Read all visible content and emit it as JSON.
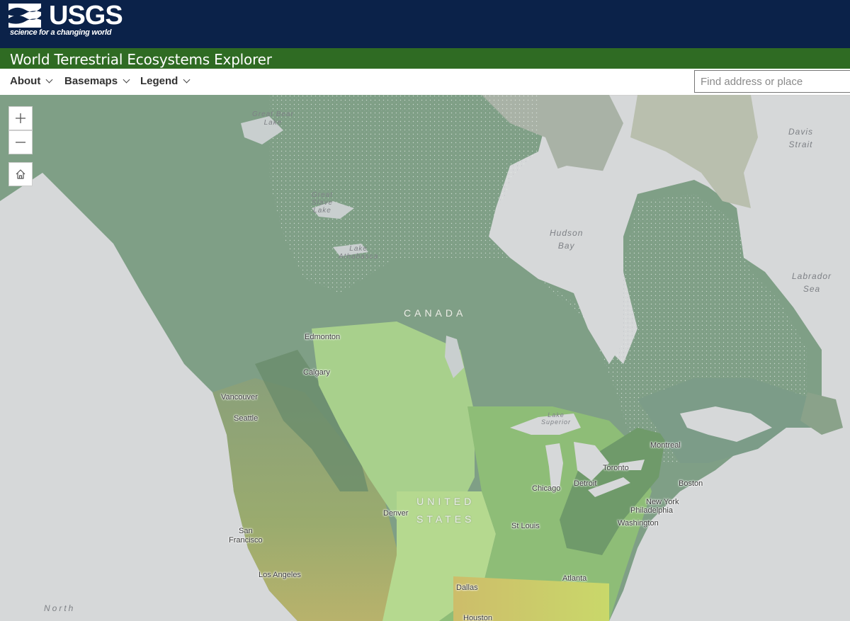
{
  "header": {
    "brand": "USGS",
    "tagline": "science for a changing world",
    "app_title": "World Terrestrial Ecosystems Explorer"
  },
  "nav": {
    "items": [
      {
        "label": "About"
      },
      {
        "label": "Basemaps"
      },
      {
        "label": "Legend"
      }
    ],
    "search_placeholder": "Find address or place"
  },
  "map": {
    "controls": {
      "zoom_in_icon": "plus-icon",
      "zoom_out_icon": "minus-icon",
      "home_icon": "home-icon"
    },
    "water_labels": {
      "great_bear_lake": "Great Bear\nLake",
      "great_slave_lake": "Great\nSlave\nLake",
      "lake_athabasca": "Lake\nAthabasca",
      "hudson_bay": "Hudson\nBay",
      "davis_strait": "Davis\nStrait",
      "labrador_sea": "Labrador\nSea",
      "lake_superior": "Lake\nSuperior",
      "north": "North"
    },
    "country_labels": {
      "canada": "CANADA",
      "united_states": "UNITED\nSTATES"
    },
    "cities": {
      "edmonton": "Edmonton",
      "calgary": "Calgary",
      "vancouver": "Vancouver",
      "seattle": "Seattle",
      "montreal": "Montreal",
      "toronto": "Toronto",
      "detroit": "Detroit",
      "chicago": "Chicago",
      "boston": "Boston",
      "new_york": "New York",
      "philadelphia": "Philadelphia",
      "washington": "Washington",
      "denver": "Denver",
      "st_louis": "St Louis",
      "san_francisco": "San\nFrancisco",
      "los_angeles": "Los Angeles",
      "dallas": "Dallas",
      "atlanta": "Atlanta",
      "houston": "Houston"
    },
    "colors": {
      "water": "#d6d8d9",
      "header": "#0b2249",
      "title_bar": "#2f6b23",
      "forest": "#6f9a6a",
      "boreal": "#7f9f8b",
      "prairie": "#a9d08e",
      "arid": "#b9b77a"
    }
  }
}
